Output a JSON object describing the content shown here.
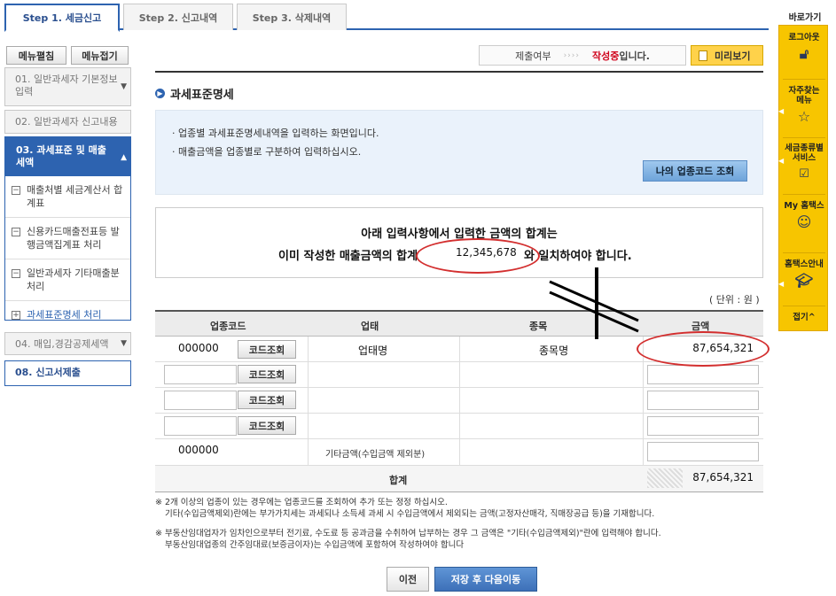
{
  "tabs": [
    {
      "label": "Step 1. 세금신고",
      "active": true
    },
    {
      "label": "Step 2. 신고내역",
      "active": false
    },
    {
      "label": "Step 3. 삭제내역",
      "active": false
    }
  ],
  "menu_controls": {
    "expand": "메뉴펼침",
    "collapse": "메뉴접기"
  },
  "menu": {
    "item1": "01. 일반과세자 기본정보입력",
    "item2": "02. 일반과세자 신고내용",
    "active_head": "03. 과세표준 및 매출세액",
    "subs": [
      "매출처별 세금계산서 합계표",
      "신용카드매출전표등 발행금액집계표 처리",
      "일반과세자 기타매출분 처리"
    ],
    "link": "과세표준명세 처리",
    "item4": "04. 매입,경감공제세액",
    "item8": "08. 신고서제출"
  },
  "status": {
    "label": "제출여부",
    "arrows": "›››› ",
    "state": "작성중",
    "suffix": "입니다."
  },
  "preview_label": "미리보기",
  "section_title": "과세표준명세",
  "info": {
    "line1": "· 업종별 과세표준명세내역을 입력하는 화면입니다.",
    "line2": "· 매출금액을 업종별로 구분하여 입력하십시오.",
    "code_lookup_button": "나의 업종코드 조회"
  },
  "notice": {
    "line1": "아래 입력사항에서  입력한 금액의 합계는",
    "line2": "이미 작성한 매출금액의 합계",
    "amount": "12,345,678",
    "line3": "와 일치하여야 합니다."
  },
  "unit": "( 단위 : 원 )",
  "table": {
    "headers": {
      "code": "업종코드",
      "business": "업태",
      "item": "종목",
      "amount": "금액"
    },
    "row1": {
      "code": "000000",
      "business": "업태명",
      "item": "종목명",
      "amount": "87,654,321"
    },
    "code_button": "코드조회",
    "other_row": {
      "code": "000000",
      "label": "기타금액(수입금액 제외분)"
    },
    "total_label": "합계",
    "total_amount": "87,654,321"
  },
  "notes": {
    "n1a": "※ 2개 이상의 업종이 있는 경우에는 업종코드를 조회하여 추가 또는 정정 하십시오.",
    "n1b": "기타(수입금액제외)란에는 부가가치세는 과세되나 소득세 과세 시 수입금액에서 제외되는 금액(고정자산매각, 직매장공급 등)을 기재합니다.",
    "n2a": "※ 부동산임대업자가 임차인으로부터 전기료, 수도료 등 공과금을 수취하여 납부하는 경우 그 금액은 \"기타(수입금액제외)\"란에 입력해야 합니다.",
    "n2b": "부동산임대업종의 간주임대료(보증금이자)는 수입금액에 포함하여 작성하여야 합니다"
  },
  "buttons": {
    "prev": "이전",
    "save_next": "저장 후 다음이동"
  },
  "quick": {
    "title": "바로가기",
    "logout": "로그아웃",
    "faq": "자주찾는 메뉴",
    "tax_service": "세금종류별 서비스",
    "my_hometax": "My 홈택스",
    "guide": "홈택스안내",
    "fold": "접기^"
  }
}
